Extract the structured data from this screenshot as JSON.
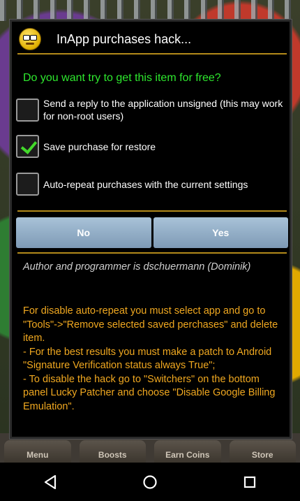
{
  "background": {
    "tabs": [
      "Menu",
      "Boosts",
      "Earn Coins",
      "Store"
    ]
  },
  "dialog": {
    "icon": "smiley-icon",
    "title": "InApp purchases hack...",
    "question": "Do you want try to get this item for free?",
    "options": [
      {
        "label": "Send a reply to the application unsigned (this may work for non-root users)",
        "checked": false
      },
      {
        "label": "Save purchase for restore",
        "checked": true
      },
      {
        "label": "Auto-repeat purchases with the current settings",
        "checked": false
      }
    ],
    "no_label": "No",
    "yes_label": "Yes",
    "author": "Author and programmer is dschuermann (Dominik)",
    "info_lines": [
      "For disable auto-repeat you must select app and go to \"Tools\"->\"Remove selected saved perchases\" and delete item.",
      "- For the best results you must make a patch to Android \"Signature Verification status always True\";",
      "- To disable the hack go to \"Switchers\" on the bottom panel Lucky Patcher and choose \"Disable Google Billing Emulation\"."
    ]
  },
  "colors": {
    "question": "#2ee82e",
    "info": "#f0a820",
    "separator": "#b38a1a",
    "button": "#8fabc6"
  },
  "navbar": {
    "icons": [
      "back-icon",
      "home-icon",
      "recents-icon"
    ]
  }
}
